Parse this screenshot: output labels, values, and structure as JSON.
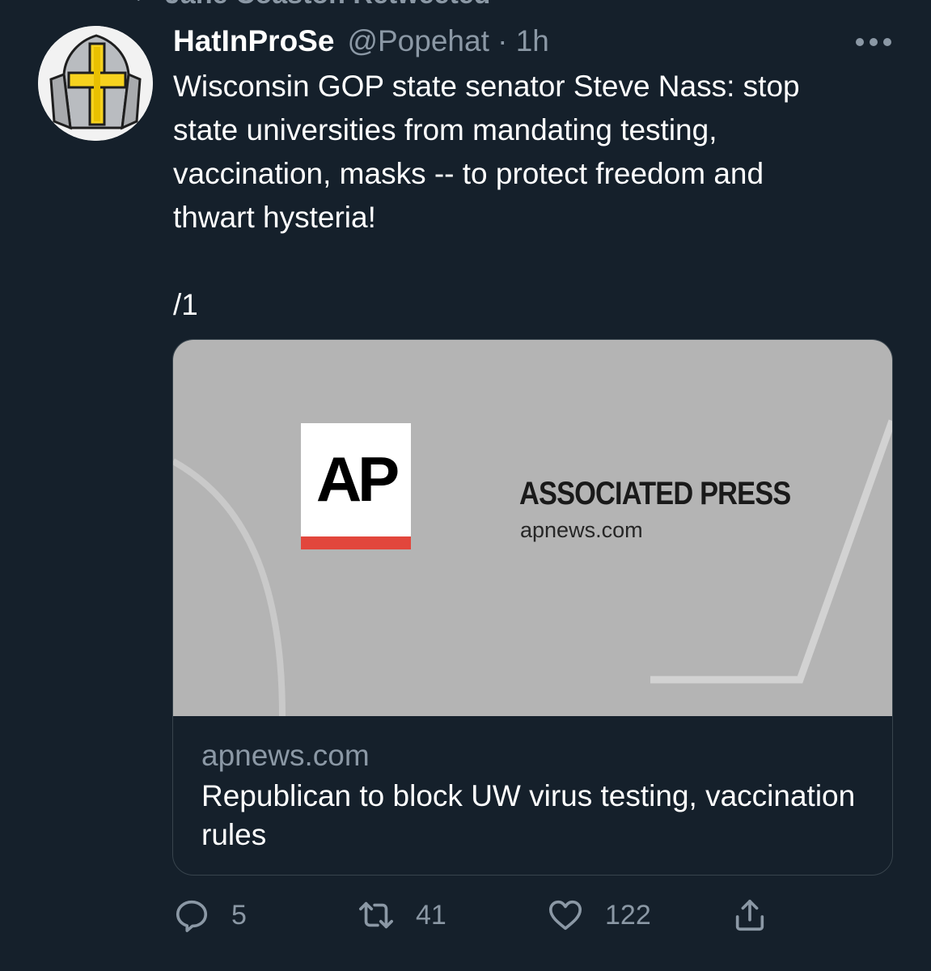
{
  "retweet_banner": {
    "text": "Jane Coaston Retweeted",
    "icon": "retweet-icon"
  },
  "tweet": {
    "author": {
      "display_name": "HatInProSe",
      "handle_and_time": "@Popehat · 1h",
      "avatar_icon": "papal-mitre-avatar"
    },
    "more_icon": "more-options-icon",
    "text": "Wisconsin GOP state senator Steve Nass: stop\nstate universities from mandating testing,\nvaccination, masks -- to protect freedom and\nthwart hysteria!\n\n/1",
    "link_card": {
      "image": {
        "logo_text": "AP",
        "brand_name": "ASSOCIATED PRESS",
        "brand_domain": "apnews.com",
        "logo_accent_color": "#e2463c"
      },
      "domain": "apnews.com",
      "title": "Republican to block UW virus testing, vaccination rules"
    },
    "actions": {
      "reply": {
        "icon": "reply-icon",
        "count": "5"
      },
      "retweet": {
        "icon": "retweet-icon",
        "count": "41"
      },
      "like": {
        "icon": "heart-icon",
        "count": "122"
      },
      "share": {
        "icon": "share-icon",
        "count": ""
      }
    }
  },
  "colors": {
    "background": "#15202b",
    "secondary_text": "#8b98a5",
    "border": "#38444d",
    "card_image_bg": "#b4b4b4"
  }
}
